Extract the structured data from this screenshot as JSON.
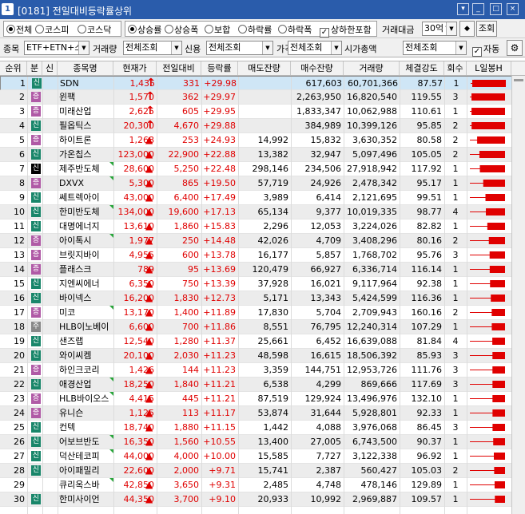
{
  "window": {
    "number": "1",
    "title": "[0181] 전일대비등락률상위",
    "btn_min": "_",
    "btn_restore": "□",
    "btn_close": "×",
    "btn_menu": "▾"
  },
  "filters": {
    "market_options": [
      "전체",
      "코스피",
      "코스닥"
    ],
    "market_selected": "전체",
    "change_options": [
      "상승률",
      "상승폭",
      "보합",
      "하락률",
      "하락폭"
    ],
    "change_selected": "상승률",
    "include_limit_label": "상하한포함",
    "include_limit_checked": true,
    "trade_amount_label": "거래대금",
    "trade_amount_value": "30억↑",
    "query_button": "조회",
    "item_label": "종목",
    "item_value": "ETF+ETN+스팩",
    "volume_label": "거래량",
    "volume_value": "전체조회",
    "credit_label": "신용",
    "credit_value": "전체조회",
    "price_label": "가격",
    "price_value": "전체조회",
    "marketcap_label": "시가총액",
    "marketcap_value": "전체조회",
    "auto_label": "자동",
    "auto_checked": true
  },
  "columns": [
    "순위",
    "분",
    "신",
    "종목명",
    "현재가",
    "전일대비",
    "등락률",
    "매도잔량",
    "매수잔량",
    "거래량",
    "체결강도",
    "회수",
    "L일봉H"
  ],
  "colors": {
    "up": "#e00000",
    "badge_shin": "#19866a",
    "badge_jeung": "#b05aa6",
    "selected_row": "#cfe6f6"
  },
  "rows": [
    {
      "rank": "1",
      "badge": "신",
      "badge_color": "shin",
      "name": "SDN",
      "price": "1,435",
      "mark": "↑",
      "change": "331",
      "rate": "+29.98",
      "sell": "",
      "buy": "617,603",
      "volume": "60,701,366",
      "strength": "87.57",
      "count": "1"
    },
    {
      "rank": "2",
      "badge": "증",
      "badge_color": "jeung",
      "name": "윈팩",
      "price": "1,570",
      "mark": "↑",
      "change": "362",
      "rate": "+29.97",
      "sell": "",
      "buy": "2,263,950",
      "volume": "16,820,540",
      "strength": "119.55",
      "count": "3"
    },
    {
      "rank": "3",
      "badge": "증",
      "badge_color": "jeung",
      "name": "미래산업",
      "price": "2,625",
      "mark": "↑",
      "change": "605",
      "rate": "+29.95",
      "sell": "",
      "buy": "1,833,347",
      "volume": "10,062,988",
      "strength": "110.61",
      "count": "1"
    },
    {
      "rank": "4",
      "badge": "신",
      "badge_color": "shin",
      "name": "필옵틱스",
      "price": "20,300",
      "mark": "↑",
      "change": "4,670",
      "rate": "+29.88",
      "sell": "",
      "buy": "384,989",
      "volume": "10,399,126",
      "strength": "95.85",
      "count": "2"
    },
    {
      "rank": "5",
      "badge": "증",
      "badge_color": "jeung",
      "name": "하이트론",
      "price": "1,268",
      "mark": "▲",
      "change": "253",
      "rate": "+24.93",
      "sell": "14,992",
      "buy": "15,832",
      "volume": "3,630,352",
      "strength": "80.58",
      "count": "2"
    },
    {
      "rank": "6",
      "badge": "신",
      "badge_color": "shin",
      "name": "가온칩스",
      "price": "123,000",
      "mark": "▲",
      "change": "22,900",
      "rate": "+22.88",
      "sell": "13,382",
      "buy": "32,947",
      "volume": "5,097,496",
      "strength": "105.05",
      "count": "2"
    },
    {
      "rank": "7",
      "badge": "신",
      "badge_color": "sinb",
      "name": "제주반도체",
      "price": "28,600",
      "mark": "▲",
      "change": "5,250",
      "rate": "+22.48",
      "sell": "298,146",
      "buy": "234,506",
      "volume": "27,918,942",
      "strength": "117.92",
      "count": "1"
    },
    {
      "rank": "8",
      "badge": "증",
      "badge_color": "jeung",
      "name": "DXVX",
      "price": "5,300",
      "mark": "▲",
      "change": "865",
      "rate": "+19.50",
      "sell": "57,719",
      "buy": "24,926",
      "volume": "2,478,342",
      "strength": "95.17",
      "count": "1"
    },
    {
      "rank": "9",
      "badge": "신",
      "badge_color": "shin",
      "name": "쎄트렉아이",
      "price": "43,000",
      "mark": "▲",
      "change": "6,400",
      "rate": "+17.49",
      "sell": "3,989",
      "buy": "6,414",
      "volume": "2,121,695",
      "strength": "99.51",
      "count": "1"
    },
    {
      "rank": "10",
      "badge": "신",
      "badge_color": "shin",
      "name": "한미반도체",
      "price": "134,000",
      "mark": "▲",
      "change": "19,600",
      "rate": "+17.13",
      "sell": "65,134",
      "buy": "9,377",
      "volume": "10,019,335",
      "strength": "98.77",
      "count": "4"
    },
    {
      "rank": "11",
      "badge": "신",
      "badge_color": "shin",
      "name": "대명에너지",
      "price": "13,610",
      "mark": "▲",
      "change": "1,860",
      "rate": "+15.83",
      "sell": "2,296",
      "buy": "12,053",
      "volume": "3,224,026",
      "strength": "82.82",
      "count": "1"
    },
    {
      "rank": "12",
      "badge": "증",
      "badge_color": "jeung",
      "name": "아이톡시",
      "price": "1,977",
      "mark": "▲",
      "change": "250",
      "rate": "+14.48",
      "sell": "42,026",
      "buy": "4,709",
      "volume": "3,408,296",
      "strength": "80.16",
      "count": "2"
    },
    {
      "rank": "13",
      "badge": "증",
      "badge_color": "jeung",
      "name": "브릿지바이",
      "price": "4,955",
      "mark": "▲",
      "change": "600",
      "rate": "+13.78",
      "sell": "16,177",
      "buy": "5,857",
      "volume": "1,768,702",
      "strength": "95.76",
      "count": "3"
    },
    {
      "rank": "14",
      "badge": "증",
      "badge_color": "jeung",
      "name": "플래스크",
      "price": "789",
      "mark": "▲",
      "change": "95",
      "rate": "+13.69",
      "sell": "120,479",
      "buy": "66,927",
      "volume": "6,336,714",
      "strength": "116.14",
      "count": "1"
    },
    {
      "rank": "15",
      "badge": "신",
      "badge_color": "shin",
      "name": "지엔씨에너",
      "price": "6,350",
      "mark": "▲",
      "change": "750",
      "rate": "+13.39",
      "sell": "37,928",
      "buy": "16,021",
      "volume": "9,117,964",
      "strength": "92.38",
      "count": "1"
    },
    {
      "rank": "16",
      "badge": "신",
      "badge_color": "shin",
      "name": "바이넥스",
      "price": "16,200",
      "mark": "▲",
      "change": "1,830",
      "rate": "+12.73",
      "sell": "5,171",
      "buy": "13,343",
      "volume": "5,424,599",
      "strength": "116.36",
      "count": "1"
    },
    {
      "rank": "17",
      "badge": "증",
      "badge_color": "jeung",
      "name": "미코",
      "price": "13,170",
      "mark": "▲",
      "change": "1,400",
      "rate": "+11.89",
      "sell": "17,830",
      "buy": "5,704",
      "volume": "2,709,943",
      "strength": "160.16",
      "count": "2"
    },
    {
      "rank": "18",
      "badge": "주",
      "badge_color": "ju",
      "name": "HLB이노베이",
      "price": "6,600",
      "mark": "▲",
      "change": "700",
      "rate": "+11.86",
      "sell": "8,551",
      "buy": "76,795",
      "volume": "12,240,314",
      "strength": "107.29",
      "count": "1"
    },
    {
      "rank": "19",
      "badge": "신",
      "badge_color": "shin",
      "name": "샌즈랩",
      "price": "12,540",
      "mark": "▲",
      "change": "1,280",
      "rate": "+11.37",
      "sell": "25,661",
      "buy": "6,452",
      "volume": "16,639,088",
      "strength": "81.84",
      "count": "4"
    },
    {
      "rank": "20",
      "badge": "신",
      "badge_color": "shin",
      "name": "와이씨켐",
      "price": "20,100",
      "mark": "▲",
      "change": "2,030",
      "rate": "+11.23",
      "sell": "48,598",
      "buy": "16,615",
      "volume": "18,506,392",
      "strength": "85.93",
      "count": "3"
    },
    {
      "rank": "21",
      "badge": "증",
      "badge_color": "jeung",
      "name": "하인크코리",
      "price": "1,426",
      "mark": "▲",
      "change": "144",
      "rate": "+11.23",
      "sell": "3,359",
      "buy": "144,751",
      "volume": "12,953,726",
      "strength": "111.76",
      "count": "3"
    },
    {
      "rank": "22",
      "badge": "신",
      "badge_color": "shin",
      "name": "애경산업",
      "price": "18,250",
      "mark": "▲",
      "change": "1,840",
      "rate": "+11.21",
      "sell": "6,538",
      "buy": "4,299",
      "volume": "869,666",
      "strength": "117.69",
      "count": "3"
    },
    {
      "rank": "23",
      "badge": "증",
      "badge_color": "jeung",
      "name": "HLB바이오스",
      "price": "4,415",
      "mark": "▲",
      "change": "445",
      "rate": "+11.21",
      "sell": "87,519",
      "buy": "129,924",
      "volume": "13,496,976",
      "strength": "132.10",
      "count": "1"
    },
    {
      "rank": "24",
      "badge": "증",
      "badge_color": "jeung",
      "name": "유니슨",
      "price": "1,125",
      "mark": "▲",
      "change": "113",
      "rate": "+11.17",
      "sell": "53,874",
      "buy": "31,644",
      "volume": "5,928,801",
      "strength": "92.33",
      "count": "1"
    },
    {
      "rank": "25",
      "badge": "신",
      "badge_color": "shin",
      "name": "컨텍",
      "price": "18,740",
      "mark": "▲",
      "change": "1,880",
      "rate": "+11.15",
      "sell": "1,442",
      "buy": "4,088",
      "volume": "3,976,068",
      "strength": "86.45",
      "count": "3"
    },
    {
      "rank": "26",
      "badge": "신",
      "badge_color": "shin",
      "name": "어보브반도",
      "price": "16,350",
      "mark": "▲",
      "change": "1,560",
      "rate": "+10.55",
      "sell": "13,400",
      "buy": "27,005",
      "volume": "6,743,500",
      "strength": "90.37",
      "count": "1"
    },
    {
      "rank": "27",
      "badge": "신",
      "badge_color": "shin",
      "name": "덕산테코피",
      "price": "44,000",
      "mark": "▲",
      "change": "4,000",
      "rate": "+10.00",
      "sell": "15,585",
      "buy": "7,727",
      "volume": "3,122,338",
      "strength": "96.92",
      "count": "1"
    },
    {
      "rank": "28",
      "badge": "신",
      "badge_color": "shin",
      "name": "아이패밀리",
      "price": "22,600",
      "mark": "▲",
      "change": "2,000",
      "rate": "+9.71",
      "sell": "15,741",
      "buy": "2,387",
      "volume": "560,427",
      "strength": "105.03",
      "count": "2"
    },
    {
      "rank": "29",
      "badge": "",
      "badge_color": "",
      "name": "큐리옥스바",
      "price": "42,850",
      "mark": "▲",
      "change": "3,650",
      "rate": "+9.31",
      "sell": "2,485",
      "buy": "4,748",
      "volume": "478,146",
      "strength": "129.89",
      "count": "1"
    },
    {
      "rank": "30",
      "badge": "신",
      "badge_color": "shin",
      "name": "한미사이언",
      "price": "44,350",
      "mark": "▲",
      "change": "3,700",
      "rate": "+9.10",
      "sell": "20,933",
      "buy": "10,992",
      "volume": "2,969,887",
      "strength": "109.57",
      "count": "1"
    }
  ]
}
